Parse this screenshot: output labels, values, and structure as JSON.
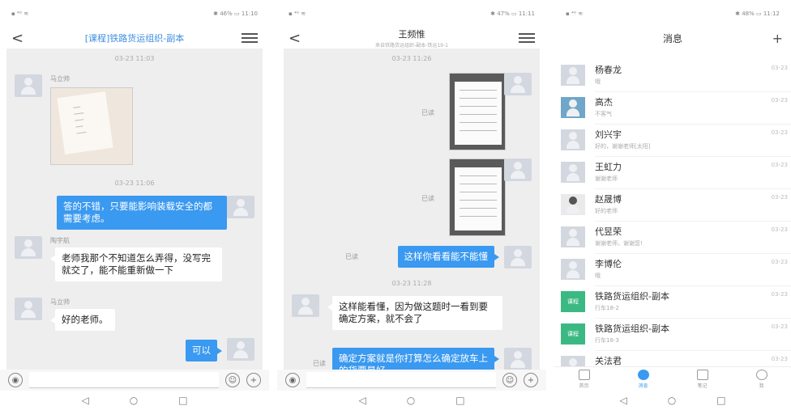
{
  "p1": {
    "status_left": "▪ ⁴ᴳ ≋",
    "status_right": "✱ 46% ▭ 11:10",
    "title": "[课程]铁路货运组织-副本",
    "messages": {
      "t1": "03-23 11:03",
      "s1": "马立帅",
      "t2": "03-23 11:06",
      "m2": "答的不错，只要能影响装载安全的都需要考虑。",
      "s3": "陶宇航",
      "m3": "老师我那个不知道怎么弄得，没写完就交了，能不能重新做一下",
      "s4": "马立帅",
      "m4": "好的老师。",
      "m5": "可以"
    }
  },
  "p2": {
    "status_left": "▪ ⁴ᴳ ≋",
    "status_right": "✱ 47% ▭ 11:11",
    "title": "王频惟",
    "subtitle": "来自铁路货运组织-副本-铁运19-1",
    "messages": {
      "t1": "03-23 11:26",
      "read": "已读",
      "m3": "这样你看看能不能懂",
      "t2": "03-23 11:28",
      "m4": "这样能看懂，因为做这题时一看到要确定方案，就不会了",
      "m5": "确定方案就是你打算怎么确定放车上的货要是好"
    }
  },
  "p3": {
    "status_left": "▪ ⁴ᴳ ≋",
    "status_right": "✱ 48% ▭ 11:12",
    "title": "消息",
    "plus": "+",
    "course_badge": "课程",
    "rows": [
      {
        "name": "杨春龙",
        "preview": "哦",
        "date": "03-23"
      },
      {
        "name": "高杰",
        "preview": "不客气",
        "date": "03-23"
      },
      {
        "name": "刘兴宇",
        "preview": "好的，谢谢老师[太阳]",
        "date": "03-23"
      },
      {
        "name": "王虹力",
        "preview": "谢谢老师",
        "date": "03-23"
      },
      {
        "name": "赵晟博",
        "preview": "好的老师",
        "date": "03-23"
      },
      {
        "name": "代昱荣",
        "preview": "谢谢老师，谢谢您!",
        "date": "03-23"
      },
      {
        "name": "李博伦",
        "preview": "哦",
        "date": "03-23"
      },
      {
        "name": "铁路货运组织-副本",
        "preview": "行车18-2",
        "date": "03-23"
      },
      {
        "name": "铁路货运组织-副本",
        "preview": "行车18-3",
        "date": "03-23"
      },
      {
        "name": "关法君",
        "preview": "",
        "date": "03-23"
      }
    ],
    "tabs": {
      "home": "首页",
      "messages": "消息",
      "notes": "笔记",
      "me": "我"
    }
  },
  "sys": {
    "back": "◁",
    "home": "○",
    "recent": "□"
  },
  "icons": {
    "voice": "◉",
    "emoji": "☺",
    "add": "+",
    "back": "<"
  }
}
